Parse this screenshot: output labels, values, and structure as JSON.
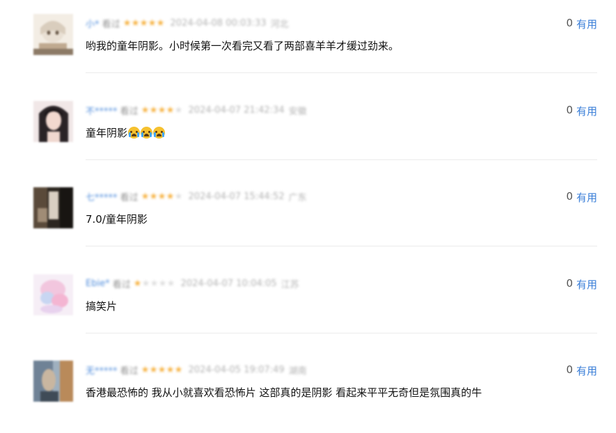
{
  "comments": [
    {
      "username": "小*",
      "watched": "看过",
      "rating": 5,
      "timestamp": "2024-04-08 00:03:33",
      "location": "河北",
      "text": "哟我的童年阴影。小时候第一次看完又看了两部喜羊羊才缓过劲来。",
      "useful_count": "0",
      "useful_label": "有用",
      "avatar": "light-cartoon"
    },
    {
      "username": "不*****",
      "watched": "看过",
      "rating": 4,
      "timestamp": "2024-04-07 21:42:34",
      "location": "安徽",
      "text": "童年阴影",
      "emoji_count": 3,
      "emoji": "loudly-crying-face",
      "useful_count": "0",
      "useful_label": "有用",
      "avatar": "dark-hair-girl"
    },
    {
      "username": "七*****",
      "watched": "看过",
      "rating": 4,
      "timestamp": "2024-04-07 15:44:52",
      "location": "广东",
      "text": "7.0/童年阴影",
      "useful_count": "0",
      "useful_label": "有用",
      "avatar": "dark-film-still"
    },
    {
      "username": "Ebie*",
      "watched": "看过",
      "rating": 1,
      "timestamp": "2024-04-07 10:04:05",
      "location": "江苏",
      "text": "搞笑片",
      "useful_count": "0",
      "useful_label": "有用",
      "avatar": "pink-cartoon"
    },
    {
      "username": "无*****",
      "watched": "看过",
      "rating": 5,
      "timestamp": "2024-04-05 19:07:49",
      "location": "湖南",
      "text": "香港最恐怖的 我从小就喜欢看恐怖片 这部真的是阴影 看起来平平无奇但是氛围真的牛",
      "useful_count": "0",
      "useful_label": "有用",
      "avatar": "grey-blue-photo"
    }
  ],
  "colors": {
    "link": "#3b7fd8",
    "star_on": "#f5a623",
    "star_off": "#d8d8d8",
    "divider": "#ececec"
  }
}
